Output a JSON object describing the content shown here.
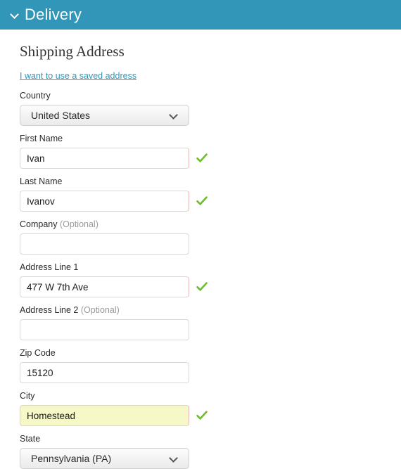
{
  "header": {
    "title": "Delivery",
    "icon": "chevron-down-icon",
    "background_color": "#3196b8",
    "text_color": "#ffffff"
  },
  "form": {
    "heading": "Shipping Address",
    "saved_address_link": "I want to use a saved address",
    "link_color": "#3196b8",
    "check_color": "#6cbe2a",
    "autofill_color": "#f7f8c8",
    "fields": [
      {
        "name": "country",
        "label": "Country",
        "optional_suffix": "",
        "type": "select",
        "value": "United States",
        "valid": false
      },
      {
        "name": "first-name",
        "label": "First Name",
        "optional_suffix": "",
        "type": "text",
        "value": "Ivan",
        "placeholder": "",
        "valid": true
      },
      {
        "name": "last-name",
        "label": "Last Name",
        "optional_suffix": "",
        "type": "text",
        "value": "Ivanov",
        "placeholder": "",
        "valid": true
      },
      {
        "name": "company",
        "label": "Company",
        "optional_suffix": "(Optional)",
        "type": "text",
        "value": "",
        "placeholder": "",
        "valid": false
      },
      {
        "name": "address-line-1",
        "label": "Address Line 1",
        "optional_suffix": "",
        "type": "text",
        "value": "477 W 7th Ave",
        "placeholder": "",
        "valid": true
      },
      {
        "name": "address-line-2",
        "label": "Address Line 2",
        "optional_suffix": "(Optional)",
        "type": "text",
        "value": "",
        "placeholder": "",
        "valid": false
      },
      {
        "name": "zip-code",
        "label": "Zip Code",
        "optional_suffix": "",
        "type": "text",
        "value": "15120",
        "placeholder": "",
        "valid": false
      },
      {
        "name": "city",
        "label": "City",
        "optional_suffix": "",
        "type": "text",
        "value": "Homestead",
        "placeholder": "",
        "valid": true,
        "autofilled": true
      },
      {
        "name": "state",
        "label": "State",
        "optional_suffix": "",
        "type": "select",
        "value": "Pennsylvania (PA)",
        "valid": false
      }
    ]
  }
}
